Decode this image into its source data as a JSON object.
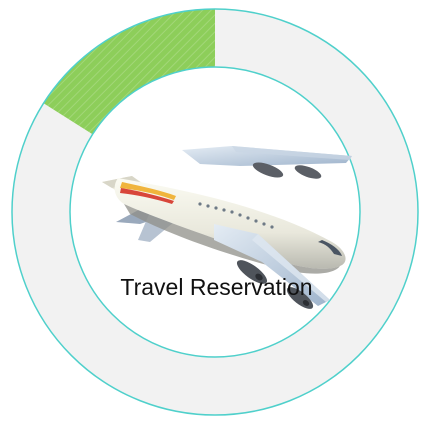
{
  "label": "Travel Reservation",
  "icon": "airplane-icon",
  "progress": {
    "fraction": 0.16,
    "fill_color": "#8dce5a",
    "track_color": "#f2f2f2"
  },
  "colors": {
    "ring_outline": "#4fd0cb",
    "text": "#111111"
  }
}
